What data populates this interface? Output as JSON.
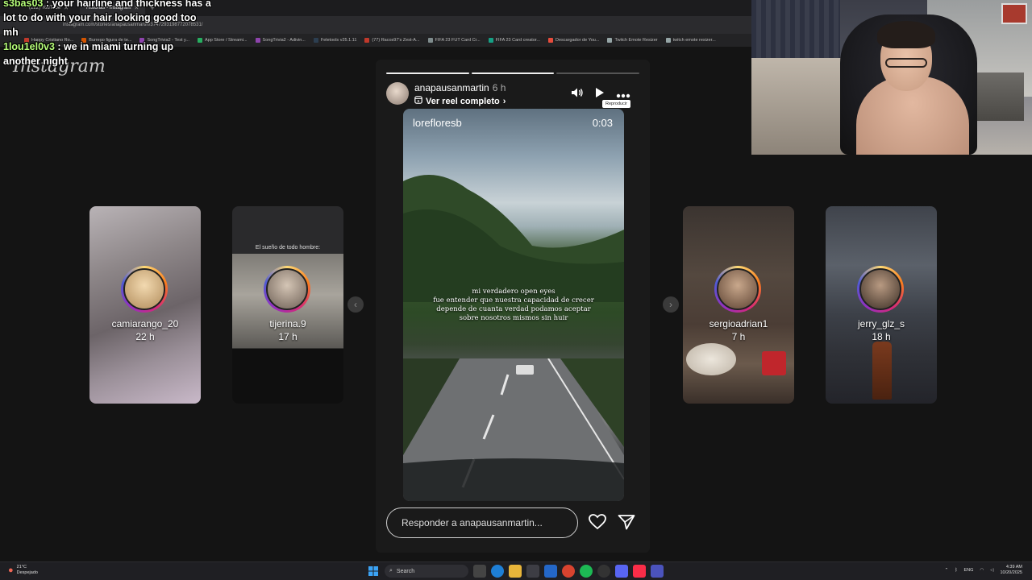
{
  "browser": {
    "tabs": [
      {
        "label": "(222) YouTube",
        "active": false
      },
      {
        "label": "Historias • Instagram",
        "active": true
      }
    ],
    "address": "instagram.com/stories/anapausanmartin/3747293198772078531/",
    "bookmarks": [
      "Happy Cristiano Ro...",
      "Burrego figura de te...",
      "SongTrivia2 - Test y...",
      "App Store / Streami...",
      "SongTrivia2 - Adivin...",
      "Feletools v25.1.11",
      "(77) Racos97's Zest-A...",
      "FIFA 23 FUT Card Cr...",
      "FIFA 23 Card creator...",
      "Descargador de You...",
      "Twitch Emote Resizer",
      "twitch emote resizer..."
    ]
  },
  "chat": [
    {
      "user": "s3bas03",
      "text": ": your hairline and thickness has a lot to do with your hair looking good too mh"
    },
    {
      "user": "1lou1el0v3",
      "text": ": we in miami turning up another night"
    }
  ],
  "logo_text": "Instagram",
  "stories_left": [
    {
      "username": "camiarango_20",
      "time": "22 h"
    },
    {
      "username": "tijerina.9",
      "time": "17 h",
      "inner_header": "El sueño de todo hombre:"
    }
  ],
  "stories_right": [
    {
      "username": "sergioadrian1",
      "time": "7 h"
    },
    {
      "username": "jerry_glz_s",
      "time": "18 h"
    }
  ],
  "viewer": {
    "username": "anapausanmartin",
    "time": "6 h",
    "reel_link": "Ver reel completo",
    "tooltip": "Reproducir",
    "media_user": "lorefloresb",
    "media_time": "0:03",
    "caption": "mi verdadero open eyes\nfue entender que nuestra capacidad de crecer\ndepende de cuanta verdad podamos aceptar\nsobre nosotros mismos sin huir",
    "reply_placeholder": "Responder a anapausanmartin..."
  },
  "taskbar": {
    "temp": "21°C",
    "weather": "Despejado",
    "search": "Search",
    "lang": "ENG",
    "time": "4:39 AM",
    "date": "10/20/2025"
  }
}
